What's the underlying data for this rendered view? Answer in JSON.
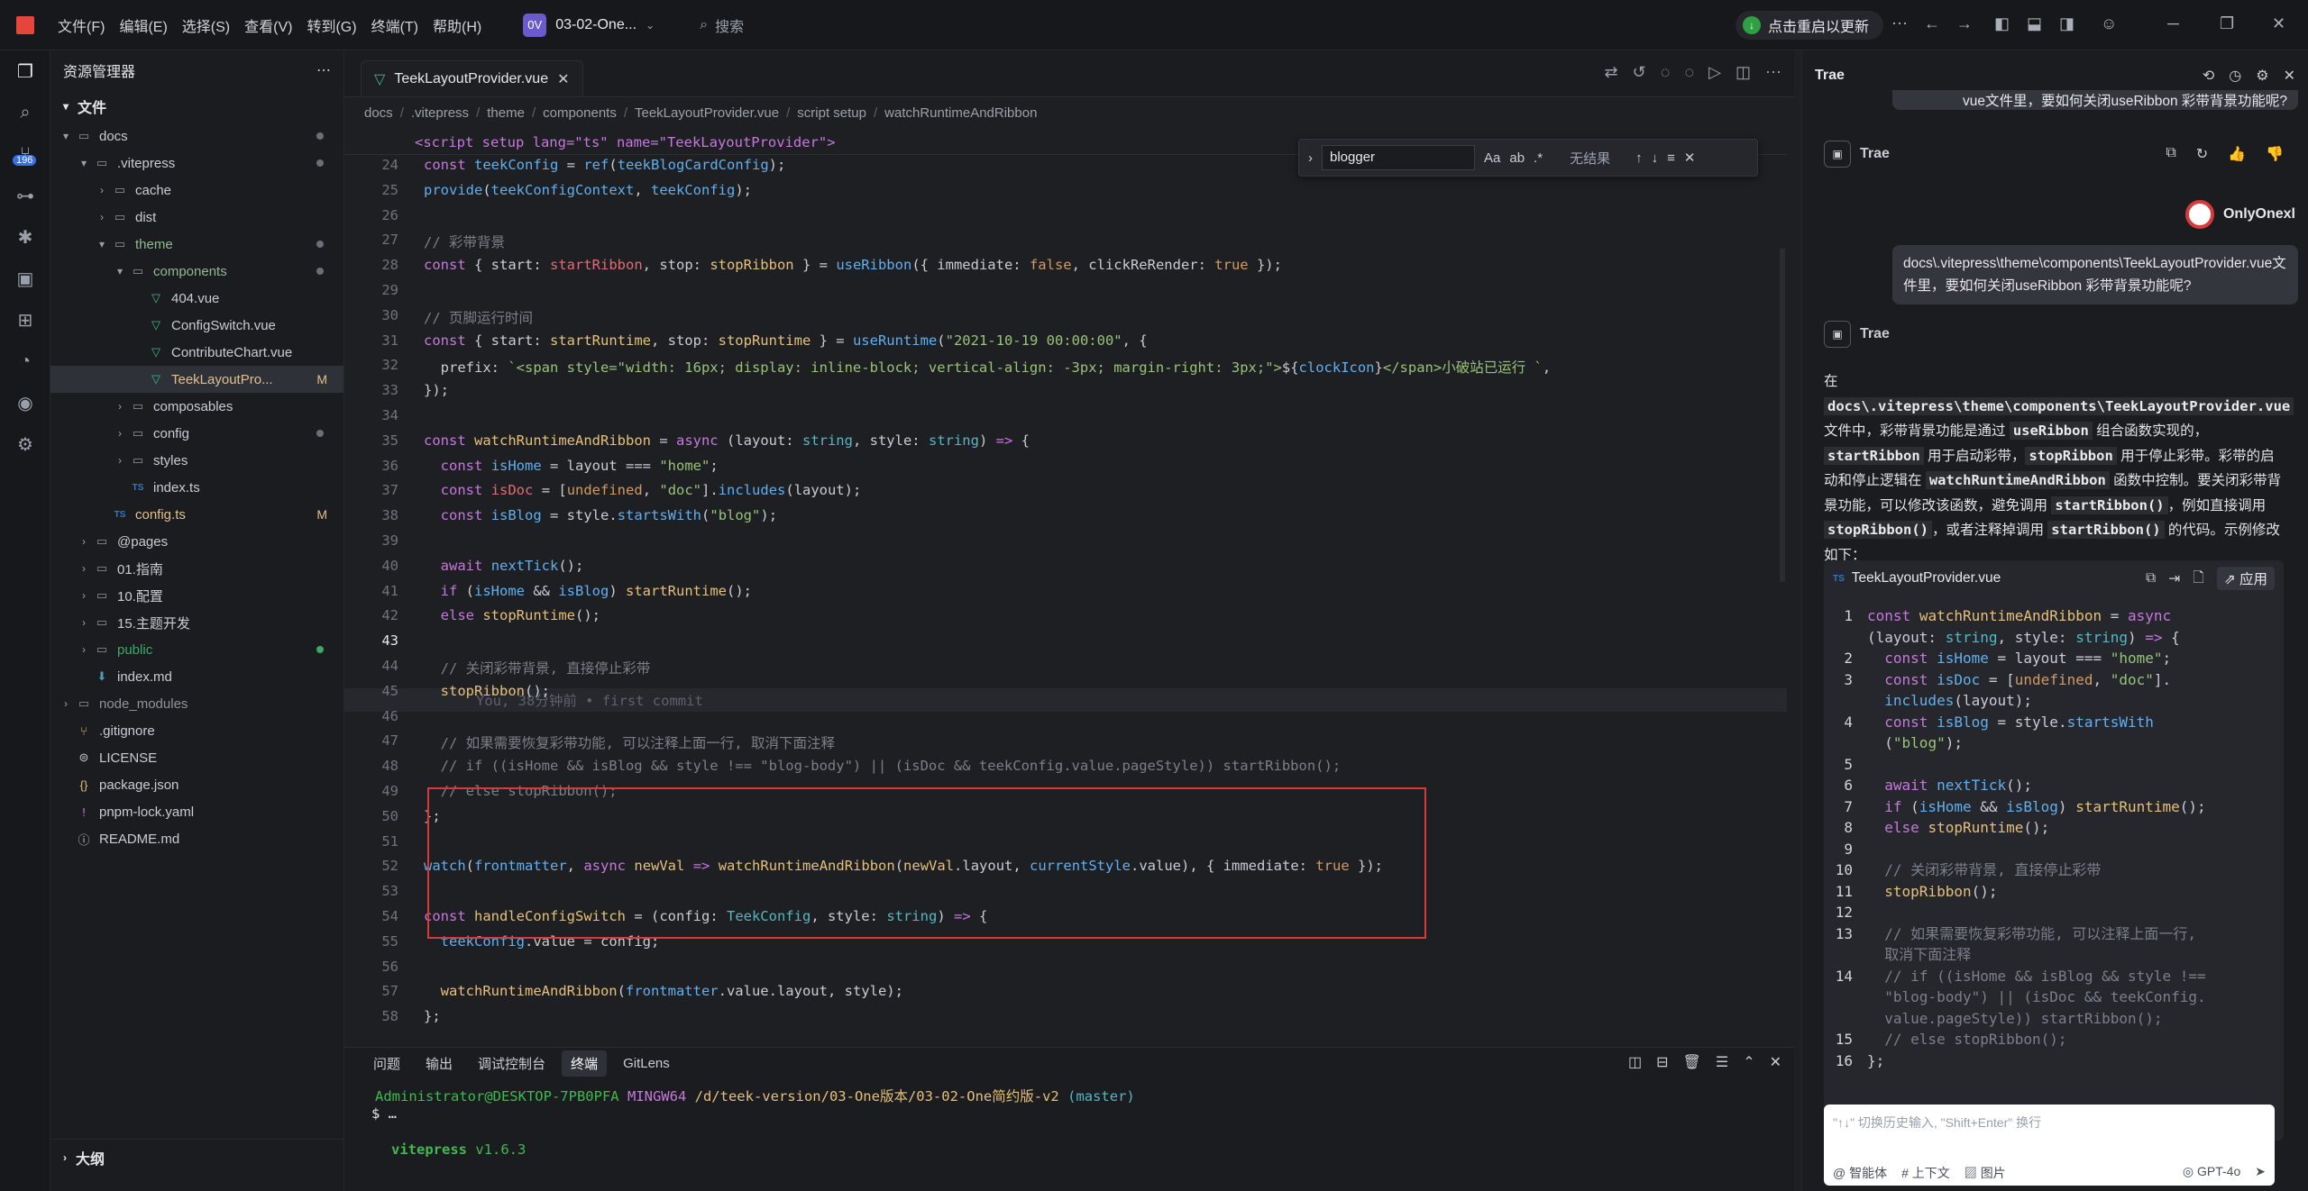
{
  "menu": [
    "文件(F)",
    "编辑(E)",
    "选择(S)",
    "查看(V)",
    "转到(G)",
    "终端(T)",
    "帮助(H)"
  ],
  "workspace": {
    "badge": "0V",
    "name": "03-02-One..."
  },
  "search": {
    "placeholder": "搜索"
  },
  "update": {
    "label": "点击重启以更新"
  },
  "activity_badge": "196",
  "explorer": {
    "title": "资源管理器",
    "section": "文件",
    "outline": "大纲",
    "tree": [
      {
        "name": "docs",
        "depth": 0,
        "type": "folder",
        "open": true,
        "dot": true
      },
      {
        "name": ".vitepress",
        "depth": 1,
        "type": "folder",
        "open": true,
        "dot": true
      },
      {
        "name": "cache",
        "depth": 2,
        "type": "folder",
        "open": false
      },
      {
        "name": "dist",
        "depth": 2,
        "type": "folder",
        "open": false
      },
      {
        "name": "theme",
        "depth": 2,
        "type": "folder",
        "open": true,
        "dot": true,
        "color": "#8fbc8f"
      },
      {
        "name": "components",
        "depth": 3,
        "type": "folder",
        "open": true,
        "dot": true,
        "color": "#8fbc8f"
      },
      {
        "name": "404.vue",
        "depth": 4,
        "type": "vue"
      },
      {
        "name": "ConfigSwitch.vue",
        "depth": 4,
        "type": "vue"
      },
      {
        "name": "ContributeChart.vue",
        "depth": 4,
        "type": "vue"
      },
      {
        "name": "TeekLayoutPro...",
        "depth": 4,
        "type": "vue",
        "selected": true,
        "status": "M"
      },
      {
        "name": "composables",
        "depth": 3,
        "type": "folder",
        "open": false
      },
      {
        "name": "config",
        "depth": 3,
        "type": "folder",
        "open": false,
        "dot": true
      },
      {
        "name": "styles",
        "depth": 3,
        "type": "folder",
        "open": false
      },
      {
        "name": "index.ts",
        "depth": 3,
        "type": "ts"
      },
      {
        "name": "config.ts",
        "depth": 2,
        "type": "ts",
        "status": "M"
      },
      {
        "name": "@pages",
        "depth": 1,
        "type": "folder",
        "open": false
      },
      {
        "name": "01.指南",
        "depth": 1,
        "type": "folder",
        "open": false
      },
      {
        "name": "10.配置",
        "depth": 1,
        "type": "folder",
        "open": false
      },
      {
        "name": "15.主题开发",
        "depth": 1,
        "type": "folder",
        "open": false
      },
      {
        "name": "public",
        "depth": 1,
        "type": "folder",
        "open": false,
        "dot": true,
        "color": "#3fa66a",
        "dotcolor": "#3fa66a"
      },
      {
        "name": "index.md",
        "depth": 1,
        "type": "md"
      },
      {
        "name": "node_modules",
        "depth": 0,
        "type": "folder",
        "open": false,
        "color": "#8e949e"
      },
      {
        "name": ".gitignore",
        "depth": 0,
        "type": "git"
      },
      {
        "name": "LICENSE",
        "depth": 0,
        "type": "lic"
      },
      {
        "name": "package.json",
        "depth": 0,
        "type": "json"
      },
      {
        "name": "pnpm-lock.yaml",
        "depth": 0,
        "type": "yaml"
      },
      {
        "name": "README.md",
        "depth": 0,
        "type": "info"
      }
    ]
  },
  "tab": {
    "label": "TeekLayoutProvider.vue"
  },
  "breadcrumb": [
    "docs",
    ".vitepress",
    "theme",
    "components",
    "TeekLayoutProvider.vue",
    "script setup",
    "watchRuntimeAndRibbon"
  ],
  "find": {
    "value": "blogger",
    "result": "无结果"
  },
  "code": {
    "sticky": "<script setup lang=\"ts\" name=\"TeekLayoutProvider\">",
    "blame": "You, 38分钟前 • first commit",
    "lines": [
      {
        "n": "24",
        "h": "<span class=k>const</span> <span class=v>teekConfig</span> = <span class=v>ref</span>(<span class=v>teekBlogCardConfig</span>);"
      },
      {
        "n": "25",
        "h": "<span class=v>provide</span>(<span class=v>teekConfigContext</span>, <span class=v>teekConfig</span>);"
      },
      {
        "n": "26",
        "h": ""
      },
      {
        "n": "27",
        "h": "<span class=c>// 彩带背景</span>"
      },
      {
        "n": "28",
        "h": "<span class=k>const</span> { start: <span class=p>startRibbon</span>, stop: <span class=f>stopRibbon</span> } = <span class=v>useRibbon</span>({ immediate: <span class=n>false</span>, clickReRender: <span class=n>true</span> });"
      },
      {
        "n": "29",
        "h": ""
      },
      {
        "n": "30",
        "h": "<span class=c>// 页脚运行时间</span>"
      },
      {
        "n": "31",
        "h": "<span class=k>const</span> { start: <span class=f>startRuntime</span>, stop: <span class=f>stopRuntime</span> } = <span class=v>useRuntime</span>(<span class=s>\"2021-10-19 00:00:00\"</span>, {"
      },
      {
        "n": "32",
        "h": "  prefix: <span class=s>`&lt;span style=\"width: 16px; display: inline-block; vertical-align: -3px; margin-right: 3px;\"&gt;</span>${<span class=v>clockIcon</span>}<span class=s>&lt;/span&gt;小破站已运行 `</span>,"
      },
      {
        "n": "33",
        "h": "});"
      },
      {
        "n": "34",
        "h": ""
      },
      {
        "n": "35",
        "h": "<span class=k>const</span> <span class=f>watchRuntimeAndRibbon</span> = <span class=k>async</span> (layout: <span class=t>string</span>, style: <span class=t>string</span>) <span class=k>=&gt;</span> {"
      },
      {
        "n": "36",
        "h": "  <span class=k>const</span> <span class=v>isHome</span> = layout === <span class=s>\"home\"</span>;"
      },
      {
        "n": "37",
        "h": "  <span class=k>const</span> <span class=p>isDoc</span> = [<span class=n>undefined</span>, <span class=s>\"doc\"</span>].<span class=v>includes</span>(layout);"
      },
      {
        "n": "38",
        "h": "  <span class=k>const</span> <span class=v>isBlog</span> = style.<span class=v>startsWith</span>(<span class=s>\"blog\"</span>);"
      },
      {
        "n": "39",
        "h": ""
      },
      {
        "n": "40",
        "h": "  <span class=k>await</span> <span class=v>nextTick</span>();"
      },
      {
        "n": "41",
        "h": "  <span class=k>if</span> (<span class=v>isHome</span> &amp;&amp; <span class=v>isBlog</span>) <span class=f>startRuntime</span>();"
      },
      {
        "n": "42",
        "h": "  <span class=k>else</span> <span class=f>stopRuntime</span>();"
      },
      {
        "n": "43",
        "h": ""
      },
      {
        "n": "44",
        "h": "  <span class=c>// 关闭彩带背景, 直接停止彩带</span>"
      },
      {
        "n": "45",
        "h": "  <span class=f>stopRibbon</span>();"
      },
      {
        "n": "46",
        "h": ""
      },
      {
        "n": "47",
        "h": "  <span class=c>// 如果需要恢复彩带功能, 可以注释上面一行, 取消下面注释</span>"
      },
      {
        "n": "48",
        "h": "  <span class=c>// if ((isHome &amp;&amp; isBlog &amp;&amp; style !== \"blog-body\") || (isDoc &amp;&amp; teekConfig.value.pageStyle)) startRibbon();</span>"
      },
      {
        "n": "49",
        "h": "  <span class=c>// else stopRibbon();</span>"
      },
      {
        "n": "50",
        "h": "};"
      },
      {
        "n": "51",
        "h": ""
      },
      {
        "n": "52",
        "h": "<span class=v>watch</span>(<span class=v>frontmatter</span>, <span class=k>async</span> <span class=f>newVal</span> <span class=k>=&gt;</span> <span class=f>watchRuntimeAndRibbon</span>(<span class=f>newVal</span>.layout, <span class=v>currentStyle</span>.value), { immediate: <span class=n>true</span> });"
      },
      {
        "n": "53",
        "h": ""
      },
      {
        "n": "54",
        "h": "<span class=k>const</span> <span class=f>handleConfigSwitch</span> = (config: <span class=t>TeekConfig</span>, style: <span class=t>string</span>) <span class=k>=&gt;</span> {"
      },
      {
        "n": "55",
        "h": "  <span class=v>teekConfig</span>.value = config;"
      },
      {
        "n": "56",
        "h": ""
      },
      {
        "n": "57",
        "h": "  <span class=f>watchRuntimeAndRibbon</span>(<span class=v>frontmatter</span>.value.layout, style);"
      },
      {
        "n": "58",
        "h": "};"
      }
    ]
  },
  "panel": {
    "tabs": [
      "问题",
      "输出",
      "调试控制台",
      "终端",
      "GitLens"
    ],
    "prompt_user": "Administrator@DESKTOP-7PB0PFA",
    "prompt_shell": "MINGW64",
    "prompt_path": "/d/teek-version/03-One版本/03-02-One简约版-v2",
    "prompt_branch": "(master)",
    "prompt_cmd": "$ …",
    "vite_name": "vitepress",
    "vite_ver": "v1.6.3"
  },
  "chat": {
    "title": "Trae",
    "prev": "vue文件里，要如何关闭useRibbon 彩带背景功能呢?",
    "ai_name": "Trae",
    "user_name": "OnlyOnexl",
    "question": "docs\\.vitepress\\theme\\components\\TeekLayoutProvider.vue文件里，要如何关闭useRibbon 彩带背景功能呢?",
    "answer_html": "在 <code>docs\\.vitepress\\theme\\components\\TeekLayoutProvider.vue</code> 文件中，彩带背景功能是通过 <code>useRibbon</code> 组合函数实现的，<code>startRibbon</code> 用于启动彩带，<code>stopRibbon</code> 用于停止彩带。彩带的启动和停止逻辑在 <code>watchRuntimeAndRibbon</code> 函数中控制。要关闭彩带背景功能，可以修改该函数，避免调用 <code>startRibbon()</code>，例如直接调用 <code>stopRibbon()</code>，或者注释掉调用 <code>startRibbon()</code> 的代码。示例修改如下：",
    "code_file": "TeekLayoutProvider.vue",
    "apply": "应用",
    "code": [
      {
        "n": "1",
        "h": "<span class=k>const</span> <span class=f>watchRuntimeAndRibbon</span> = <span class=k>async</span>\n(layout: <span class=t>string</span>, style: <span class=t>string</span>) <span class=k>=&gt;</span> {"
      },
      {
        "n": "2",
        "h": "  <span class=k>const</span> <span class=v>isHome</span> = layout === <span class=s>\"home\"</span>;"
      },
      {
        "n": "3",
        "h": "  <span class=k>const</span> <span class=v>isDoc</span> = [<span class=n>undefined</span>, <span class=s>\"doc\"</span>].\n  <span class=v>includes</span>(layout);"
      },
      {
        "n": "4",
        "h": "  <span class=k>const</span> <span class=v>isBlog</span> = style.<span class=v>startsWith</span>\n  (<span class=s>\"blog\"</span>);"
      },
      {
        "n": "5",
        "h": ""
      },
      {
        "n": "6",
        "h": "  <span class=k>await</span> <span class=v>nextTick</span>();"
      },
      {
        "n": "7",
        "h": "  <span class=k>if</span> (<span class=v>isHome</span> &amp;&amp; <span class=v>isBlog</span>) <span class=f>startRuntime</span>();"
      },
      {
        "n": "8",
        "h": "  <span class=k>else</span> <span class=f>stopRuntime</span>();"
      },
      {
        "n": "9",
        "h": ""
      },
      {
        "n": "10",
        "h": "  <span class=c>// 关闭彩带背景, 直接停止彩带</span>"
      },
      {
        "n": "11",
        "h": "  <span class=f>stopRibbon</span>();"
      },
      {
        "n": "12",
        "h": ""
      },
      {
        "n": "13",
        "h": "  <span class=c>// 如果需要恢复彩带功能, 可以注释上面一行,\n  取消下面注释</span>"
      },
      {
        "n": "14",
        "h": "  <span class=c>// if ((isHome &amp;&amp; isBlog &amp;&amp; style !==\n  \"blog-body\") || (isDoc &amp;&amp; teekConfig.\n  value.pageStyle)) startRibbon();</span>"
      },
      {
        "n": "15",
        "h": "  <span class=c>// else stopRibbon();</span>"
      },
      {
        "n": "16",
        "h": "};"
      }
    ],
    "input_placeholder": "\"↑↓\" 切换历史输入, \"Shift+Enter\" 换行",
    "tools": [
      "@ 智能体",
      "# 上下文",
      "图片"
    ],
    "model": "GPT-4o"
  }
}
